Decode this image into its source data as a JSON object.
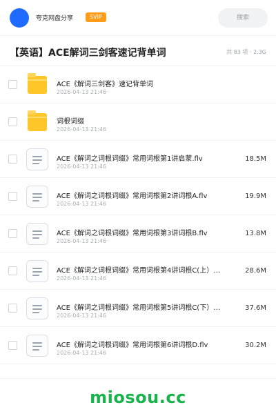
{
  "header": {
    "share_title": "夸克网盘分享",
    "svip_label": "SVIP",
    "search_label": "搜索"
  },
  "folder": {
    "title": "【英语】ACE解词三剑客速记背单词",
    "meta": "共 83 项 · 2.3G"
  },
  "files": [
    {
      "name": "ACE《解词三剑客》速记背单词",
      "date": "2026-04-13 21:46",
      "type": "folder",
      "icon": "folder-icon",
      "size": ""
    },
    {
      "name": "词根词缀",
      "date": "2026-04-13 21:46",
      "type": "folder",
      "icon": "folder-icon",
      "size": ""
    },
    {
      "name": "ACE《解词之词根词缀》常用词根第1讲启蒙.flv",
      "date": "2026-04-13 21:46",
      "type": "video",
      "icon": "video-file-icon",
      "size": "18.5M"
    },
    {
      "name": "ACE《解词之词根词缀》常用词根第2讲词根A.flv",
      "date": "2026-04-13 21:46",
      "type": "video",
      "icon": "video-file-icon",
      "size": "19.9M"
    },
    {
      "name": "ACE《解词之词根词缀》常用词根第3讲词根B.flv",
      "date": "2026-04-13 21:46",
      "type": "video",
      "icon": "video-file-icon",
      "size": "13.8M"
    },
    {
      "name": "ACE《解词之词根词缀》常用词根第4讲词根C(上）…",
      "date": "2026-04-13 21:46",
      "type": "video",
      "icon": "video-file-icon",
      "size": "28.6M"
    },
    {
      "name": "ACE《解词之词根词缀》常用词根第5讲词根C(下）…",
      "date": "2026-04-13 21:46",
      "type": "video",
      "icon": "video-file-icon",
      "size": "37.6M"
    },
    {
      "name": "ACE《解词之词根词缀》常用词根第6讲词根D.flv",
      "date": "2026-04-13 21:46",
      "type": "video",
      "icon": "video-file-icon",
      "size": "30.2M"
    }
  ],
  "footer": {
    "brand": "miosou.cc"
  },
  "colors": {
    "avatar": "#1f6bff",
    "svip": "#ff9c1a",
    "folder": "#ffc629",
    "brand": "#18b34a"
  }
}
